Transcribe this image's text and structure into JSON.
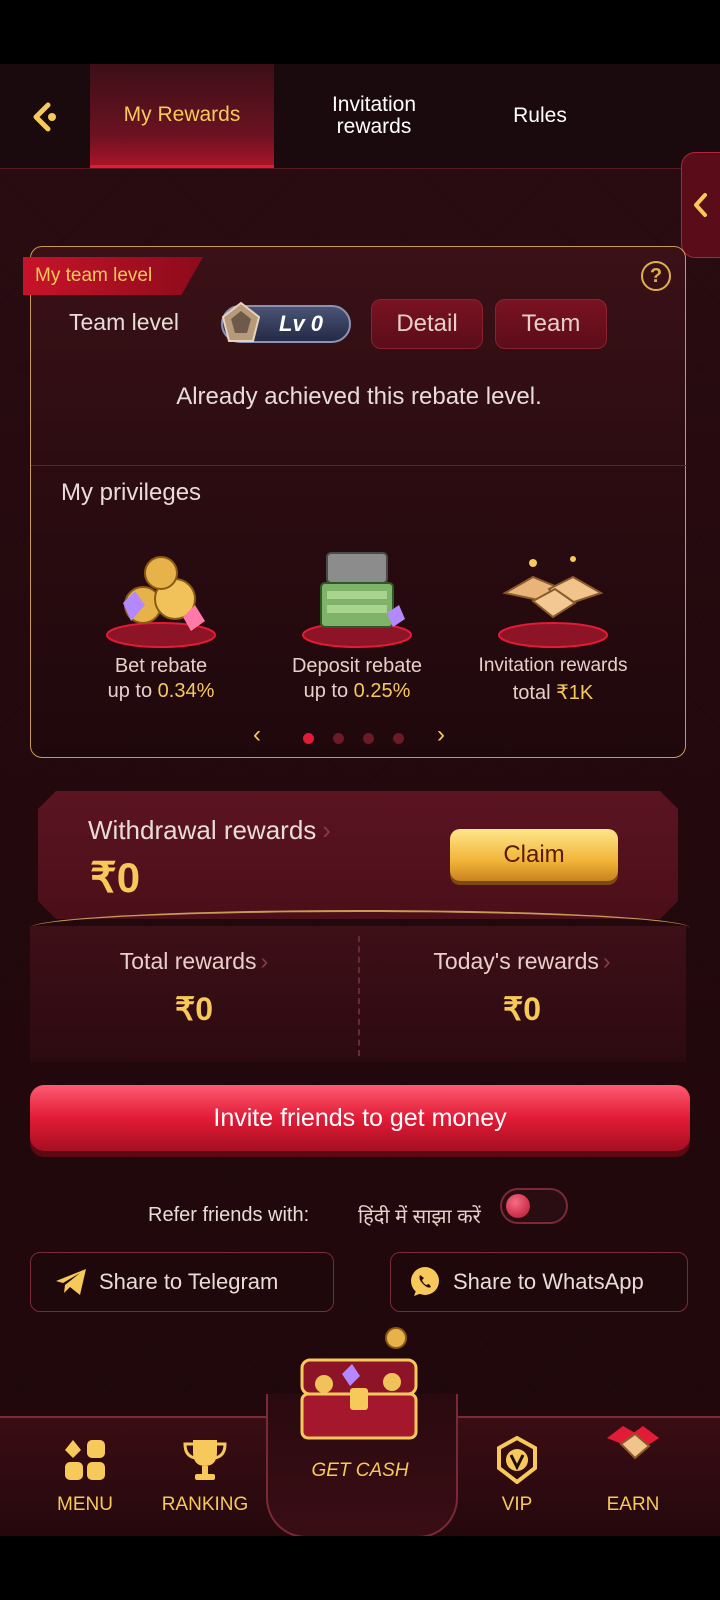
{
  "header": {
    "tabs": [
      {
        "label": "My Rewards",
        "active": true
      },
      {
        "label_line1": "Invitation",
        "label_line2": "rewards",
        "active": false
      },
      {
        "label": "Rules",
        "active": false
      }
    ]
  },
  "team": {
    "ribbon": "My team level",
    "level_label": "Team level",
    "level_badge": "Lv 0",
    "detail_button": "Detail",
    "team_button": "Team",
    "status": "Already achieved this rebate level.",
    "help_glyph": "?"
  },
  "privileges": {
    "title": "My privileges",
    "items": [
      {
        "line1": "Bet rebate",
        "line2_prefix": "up to ",
        "line2_value": "0.34%",
        "icon": "coins-gems-icon"
      },
      {
        "line1": "Deposit rebate",
        "line2_prefix": "up to ",
        "line2_value": "0.25%",
        "icon": "cash-chest-icon"
      },
      {
        "line1": "Invitation rewards",
        "line2_prefix": "total ",
        "line2_value": "₹1K",
        "icon": "handshake-icon"
      }
    ],
    "prev": "‹",
    "next": "›",
    "page_count": 4,
    "current_page": 1
  },
  "withdrawal": {
    "title": "Withdrawal rewards",
    "chevron": "›",
    "amount": "₹0",
    "claim_label": "Claim"
  },
  "rewards": {
    "total_label": "Total rewards",
    "total_value": "₹0",
    "today_label": "Today's rewards",
    "today_value": "₹0",
    "chevron": "›"
  },
  "invite_button": "Invite friends to get money",
  "refer": {
    "label": "Refer friends with:",
    "hindi": "हिंदी में साझा करें",
    "toggle_on": false
  },
  "share": {
    "telegram": "Share to Telegram",
    "whatsapp": "Share to WhatsApp"
  },
  "bottom_nav": {
    "menu": "MENU",
    "ranking": "RANKING",
    "get_cash": "GET CASH",
    "vip": "VIP",
    "earn": "EARN"
  },
  "colors": {
    "accent_gold": "#f6c95a",
    "accent_red": "#e21b36",
    "background": "#24090e"
  }
}
